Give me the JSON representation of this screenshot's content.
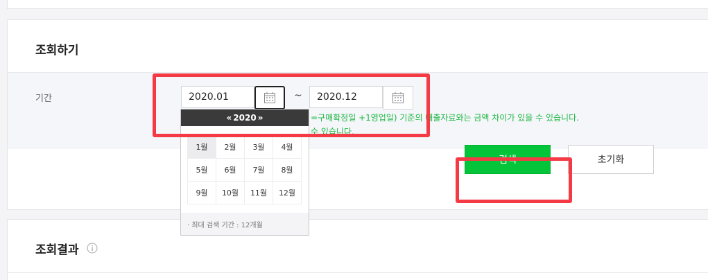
{
  "search": {
    "title": "조회하기",
    "period_label": "기간",
    "start_date": "2020.01",
    "end_date": "2020.12",
    "separator": "~",
    "notice_line1": "=구매확정일 +1영업일) 기준의 매출자료와는 금액 차이가 있을 수 있습니다.",
    "notice_line2": "수 있습니다.",
    "search_button": "검색",
    "reset_button": "초기화"
  },
  "picker": {
    "prev_label": "«",
    "year": "2020",
    "next_label": "»",
    "selected_month": "1월",
    "months": [
      "1월",
      "2월",
      "3월",
      "4월",
      "5월",
      "6월",
      "7월",
      "8월",
      "9월",
      "10월",
      "11월",
      "12월"
    ],
    "footer_note": "· 최대 검색 기간 : 12개월"
  },
  "results": {
    "title": "조회결과",
    "info_icon": "info-icon"
  },
  "colors": {
    "primary_green": "#04c43a",
    "notice_green": "#1fb845",
    "highlight_red": "#f43a45",
    "picker_header": "#3a3a3a"
  }
}
